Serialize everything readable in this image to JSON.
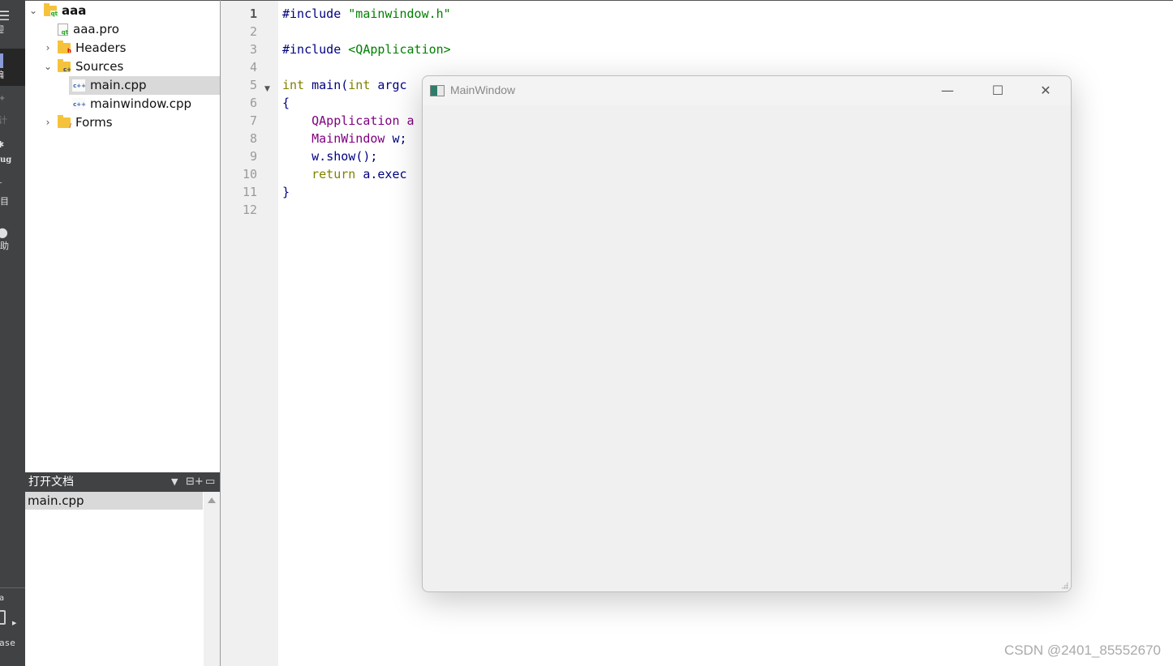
{
  "modebar": {
    "items": [
      {
        "label": "迎"
      },
      {
        "label": "编"
      },
      {
        "label": ""
      },
      {
        "label": "计"
      },
      {
        "label": "ug"
      },
      {
        "label": "目"
      },
      {
        "label": "助"
      }
    ],
    "kit": "a",
    "build": "ase"
  },
  "project_tree": {
    "items": [
      {
        "label": "aaa",
        "icon": "qt-project-folder-icon",
        "expanded": true
      },
      {
        "label": "aaa.pro",
        "icon": "qt-pro-file-icon"
      },
      {
        "label": "Headers",
        "icon": "headers-folder-icon",
        "expanded": false
      },
      {
        "label": "Sources",
        "icon": "sources-folder-icon",
        "expanded": true
      },
      {
        "label": "main.cpp",
        "icon": "cpp-file-icon",
        "selected": true
      },
      {
        "label": "mainwindow.cpp",
        "icon": "cpp-file-icon"
      },
      {
        "label": "Forms",
        "icon": "forms-folder-icon",
        "expanded": false
      }
    ]
  },
  "open_documents": {
    "title": "打开文档",
    "items": [
      "main.cpp"
    ]
  },
  "editor": {
    "line_numbers": [
      "1",
      "2",
      "3",
      "4",
      "5",
      "6",
      "7",
      "8",
      "9",
      "10",
      "11",
      "12"
    ],
    "current_line": 1,
    "lines": [
      [
        {
          "t": "#include ",
          "c": "pp"
        },
        {
          "t": "\"mainwindow.h\"",
          "c": "str"
        }
      ],
      [],
      [
        {
          "t": "#include ",
          "c": "pp"
        },
        {
          "t": "<QApplication>",
          "c": "str"
        }
      ],
      [],
      [
        {
          "t": "int ",
          "c": "kw"
        },
        {
          "t": "main(",
          "c": "pp"
        },
        {
          "t": "int ",
          "c": "kw"
        },
        {
          "t": "argc",
          "c": "pp"
        }
      ],
      [
        {
          "t": "{",
          "c": "pp"
        }
      ],
      [
        {
          "t": "    QApplication a",
          "c": "ty"
        }
      ],
      [
        {
          "t": "    MainWindow ",
          "c": "ty"
        },
        {
          "t": "w;",
          "c": "pp"
        }
      ],
      [
        {
          "t": "    w.",
          "c": "pp"
        },
        {
          "t": "show",
          "c": "pp"
        },
        {
          "t": "();",
          "c": "pp"
        }
      ],
      [
        {
          "t": "    return ",
          "c": "kw"
        },
        {
          "t": "a.exec",
          "c": "pp"
        }
      ],
      [
        {
          "t": "}",
          "c": "pp"
        }
      ],
      []
    ]
  },
  "app_window": {
    "title": "MainWindow",
    "minimize": "—",
    "maximize": "☐",
    "close": "✕"
  },
  "watermark": "CSDN @2401_85552670"
}
